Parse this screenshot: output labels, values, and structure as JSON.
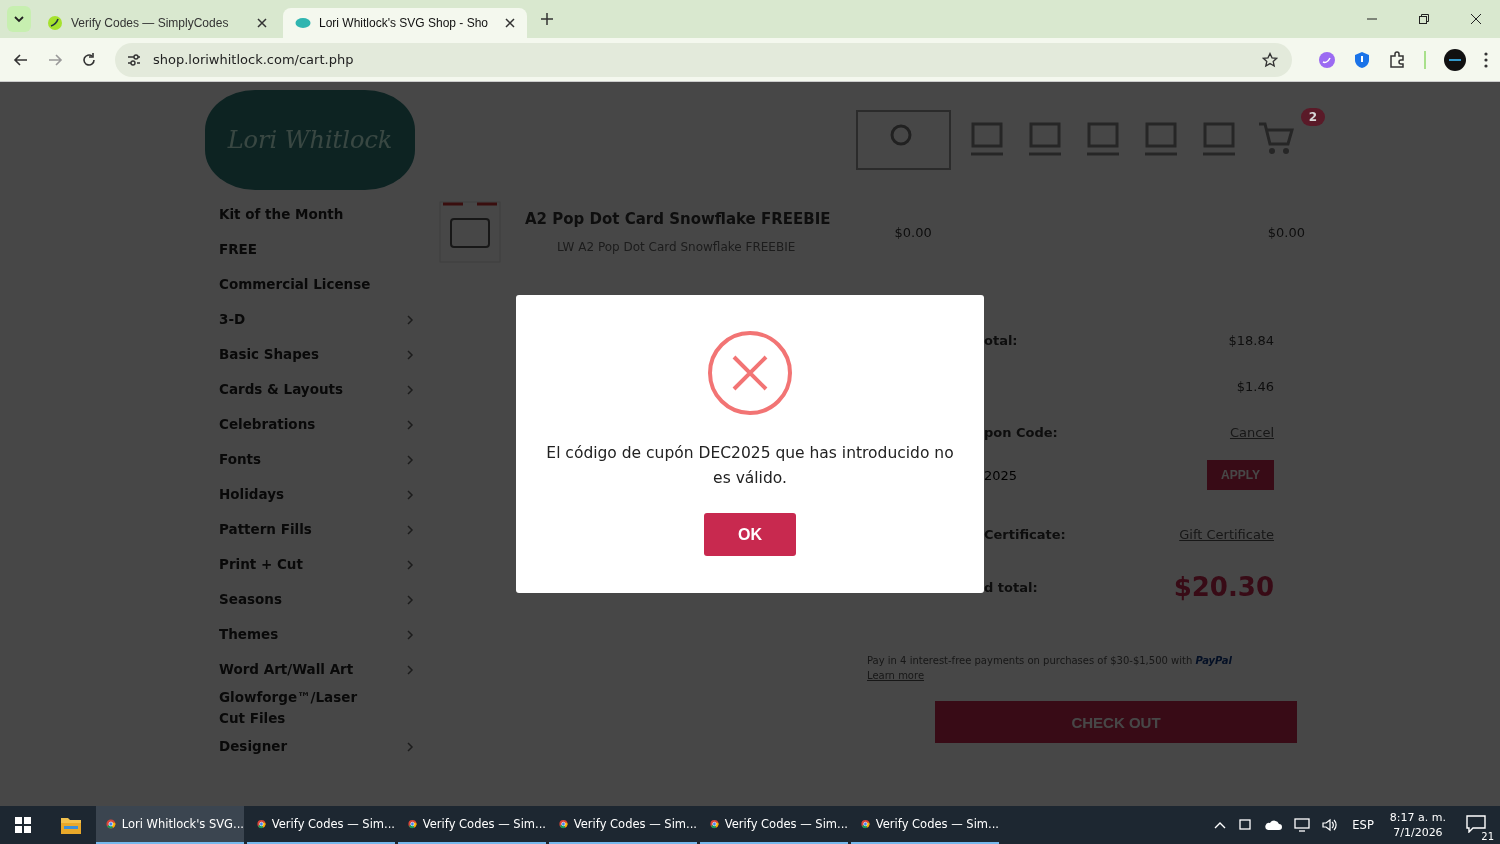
{
  "browser": {
    "tabs": [
      {
        "title": "Verify Codes — SimplyCodes",
        "selected": false
      },
      {
        "title": "Lori Whitlock's SVG Shop - Sho",
        "selected": true
      }
    ],
    "url": "shop.loriwhitlock.com/cart.php"
  },
  "page": {
    "logo": "Lori Whitlock",
    "cart_count": "2",
    "sidebar": [
      {
        "label": "Kit of the Month",
        "has_children": false
      },
      {
        "label": "FREE",
        "has_children": false
      },
      {
        "label": "Commercial License",
        "has_children": false
      },
      {
        "label": "3-D",
        "has_children": true
      },
      {
        "label": "Basic Shapes",
        "has_children": true
      },
      {
        "label": "Cards & Layouts",
        "has_children": true
      },
      {
        "label": "Celebrations",
        "has_children": true
      },
      {
        "label": "Fonts",
        "has_children": true
      },
      {
        "label": "Holidays",
        "has_children": true
      },
      {
        "label": "Pattern Fills",
        "has_children": true
      },
      {
        "label": "Print + Cut",
        "has_children": true
      },
      {
        "label": "Seasons",
        "has_children": true
      },
      {
        "label": "Themes",
        "has_children": true
      },
      {
        "label": "Word Art/Wall Art",
        "has_children": true
      },
      {
        "label": "Glowforge™/Laser Cut Files",
        "has_children": false
      },
      {
        "label": "Designer",
        "has_children": true
      }
    ],
    "cart_item": {
      "title": "A2 Pop Dot Card Snowflake FREEBIE",
      "sku": "LW A2 Pop Dot Card Snowflake FREEBIE",
      "price": "$0.00",
      "total": "$0.00"
    },
    "summary": [
      {
        "kind": "amount",
        "label": "otal:",
        "value": "$18.84"
      },
      {
        "kind": "amount",
        "value": "$1.46"
      },
      {
        "kind": "link",
        "label": "pon Code:",
        "value": "Cancel"
      },
      {
        "kind": "input",
        "label": "2025",
        "value": "APPLY"
      },
      {
        "kind": "link",
        "label": "Certificate:",
        "value": "Gift Certificate"
      },
      {
        "kind": "total",
        "label": "d total:",
        "value": "$20.30"
      }
    ],
    "paypal": {
      "text": "Pay in 4 interest-free payments on purchases of $30-$1,500 with",
      "brand": "PayPal",
      "link": "Learn more"
    },
    "checkout": "CHECK OUT"
  },
  "dialog": {
    "message": "El código de cupón DEC2025 que has introducido no es válido.",
    "button": "OK"
  },
  "taskbar": {
    "items": [
      {
        "label": "Lori Whitlock's SVG...",
        "selected": true
      },
      {
        "label": "Verify Codes — Sim...",
        "selected": false
      },
      {
        "label": "Verify Codes — Sim...",
        "selected": false
      },
      {
        "label": "Verify Codes — Sim...",
        "selected": false
      },
      {
        "label": "Verify Codes — Sim...",
        "selected": false
      },
      {
        "label": "Verify Codes — Sim...",
        "selected": false
      }
    ],
    "language": "ESP",
    "time": "8:17 a. m.",
    "date": "7/1/2026",
    "notifications": "21"
  }
}
